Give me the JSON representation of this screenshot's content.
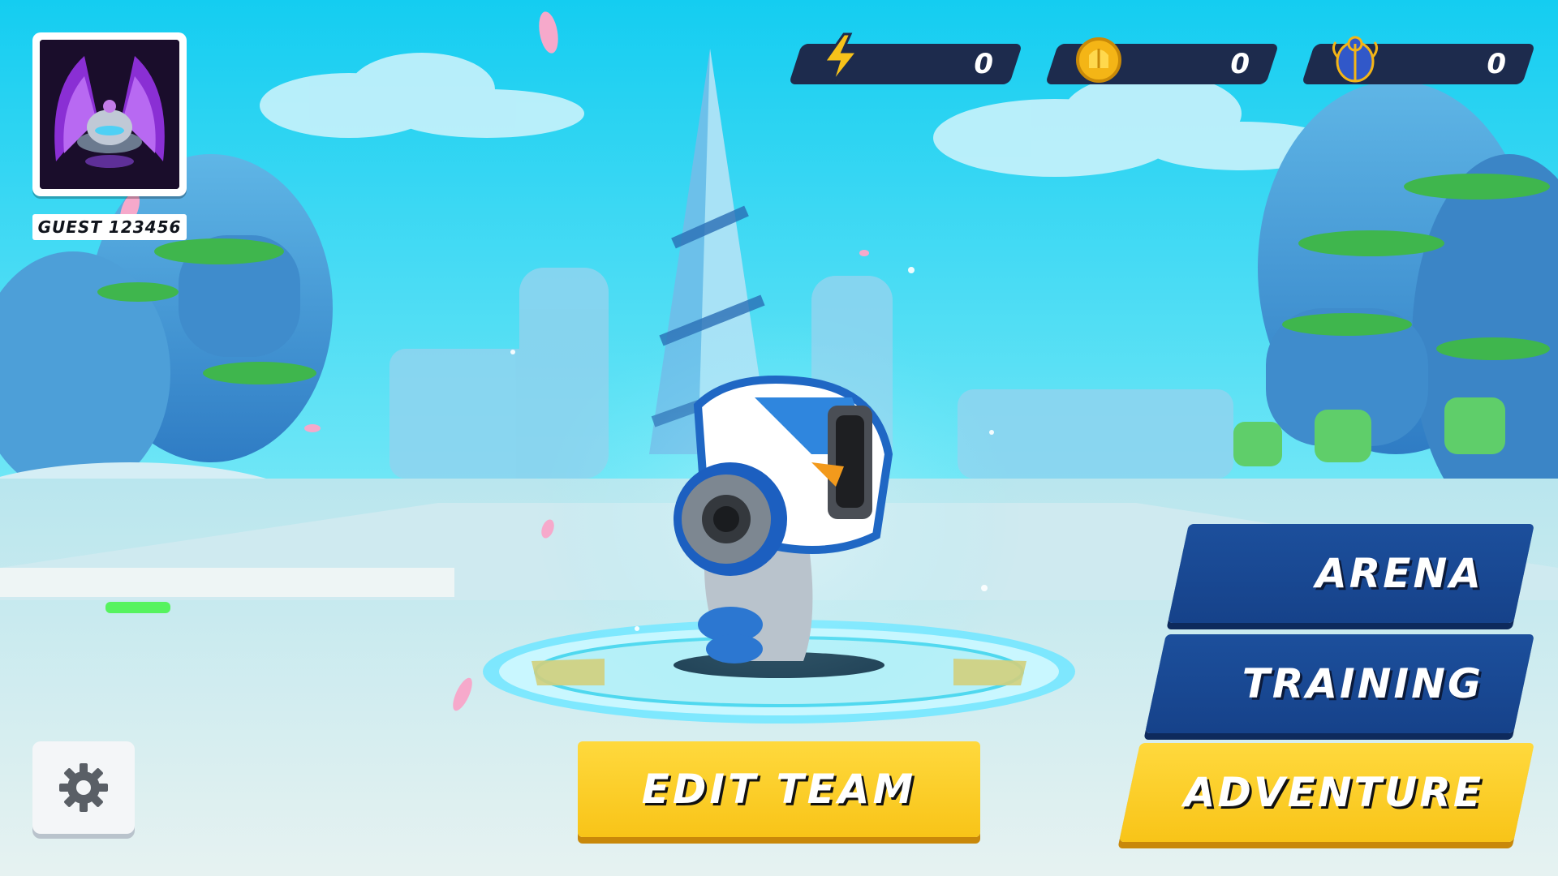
{
  "player": {
    "name": "GUEST 123456",
    "avatar_icon": "purple-ufo-avatar-icon"
  },
  "currencies": [
    {
      "icon": "lightning-energy-icon",
      "value": "0",
      "color": "#f7c21a"
    },
    {
      "icon": "gold-coin-icon",
      "value": "0",
      "color": "#f4b516"
    },
    {
      "icon": "blue-beetle-gem-icon",
      "value": "0",
      "color": "#3158c9"
    }
  ],
  "menu": {
    "arena_label": "ARENA",
    "training_label": "TRAINING",
    "adventure_label": "ADVENTURE",
    "edit_team_label": "EDIT TEAM"
  },
  "settings": {
    "icon": "gear-icon"
  },
  "colors": {
    "sky": "#20d4f2",
    "button_blue": "#1c4f9c",
    "button_yellow": "#ffd93d",
    "currency_bar": "#1d2b4d"
  }
}
